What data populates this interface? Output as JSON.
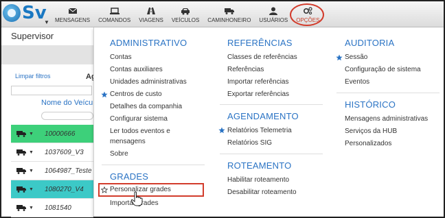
{
  "logo": {
    "text": "Sv"
  },
  "nav": {
    "items": [
      {
        "label": "MENSAGENS",
        "icon": "envelope-icon"
      },
      {
        "label": "COMANDOS",
        "icon": "laptop-icon"
      },
      {
        "label": "VIAGENS",
        "icon": "road-icon"
      },
      {
        "label": "VEÍCULOS",
        "icon": "car-icon"
      },
      {
        "label": "CAMINHONEIRO",
        "icon": "truck-icon"
      },
      {
        "label": "USUÁRIOS",
        "icon": "user-icon"
      },
      {
        "label": "OPÇÕES",
        "icon": "gears-icon"
      }
    ]
  },
  "page": {
    "title": "Supervisor",
    "clear_filters": "Limpar filtros",
    "column_fragment": "Ag",
    "column_header": "Nome do Veículo",
    "rows": [
      {
        "value": "10000666",
        "color": "#3dd07a"
      },
      {
        "value": "1037609_V3",
        "color": "#ffffff"
      },
      {
        "value": "1064987_Teste",
        "color": "#ffffff"
      },
      {
        "value": "1080270_V4",
        "color": "#3cc9c7"
      },
      {
        "value": "1081540",
        "color": "#ffffff"
      }
    ]
  },
  "menu": {
    "administrativo": {
      "title": "ADMINISTRATIVO",
      "items": [
        "Contas",
        "Contas auxiliares",
        "Unidades administrativas",
        "Centros de custo",
        "Detalhes da companhia",
        "Configurar sistema",
        "Ler todos eventos e",
        "mensagens",
        "Sobre"
      ]
    },
    "grades": {
      "title": "GRADES",
      "items": [
        "Personalizar grades",
        "Importar grades"
      ]
    },
    "referencias": {
      "title": "REFERÊNCIAS",
      "items": [
        "Classes de referências",
        "Referências",
        "Importar referências",
        "Exportar referências"
      ]
    },
    "agendamento": {
      "title": "AGENDAMENTO",
      "items": [
        "Relatórios Telemetria",
        "Relatórios SIG"
      ]
    },
    "roteamento": {
      "title": "ROTEAMENTO",
      "items": [
        "Habilitar roteamento",
        "Desabilitar roteamento"
      ]
    },
    "auditoria": {
      "title": "AUDITORIA",
      "items": [
        "Sessão",
        "Configuração de sistema",
        "Eventos"
      ]
    },
    "historico": {
      "title": "HISTÓRICO",
      "items": [
        "Mensagens administrativas",
        "Serviços da HUB",
        "Personalizados"
      ]
    }
  },
  "colors": {
    "accent": "#2a73c4",
    "highlight": "#d23b2b",
    "star": "#2a73c4"
  }
}
